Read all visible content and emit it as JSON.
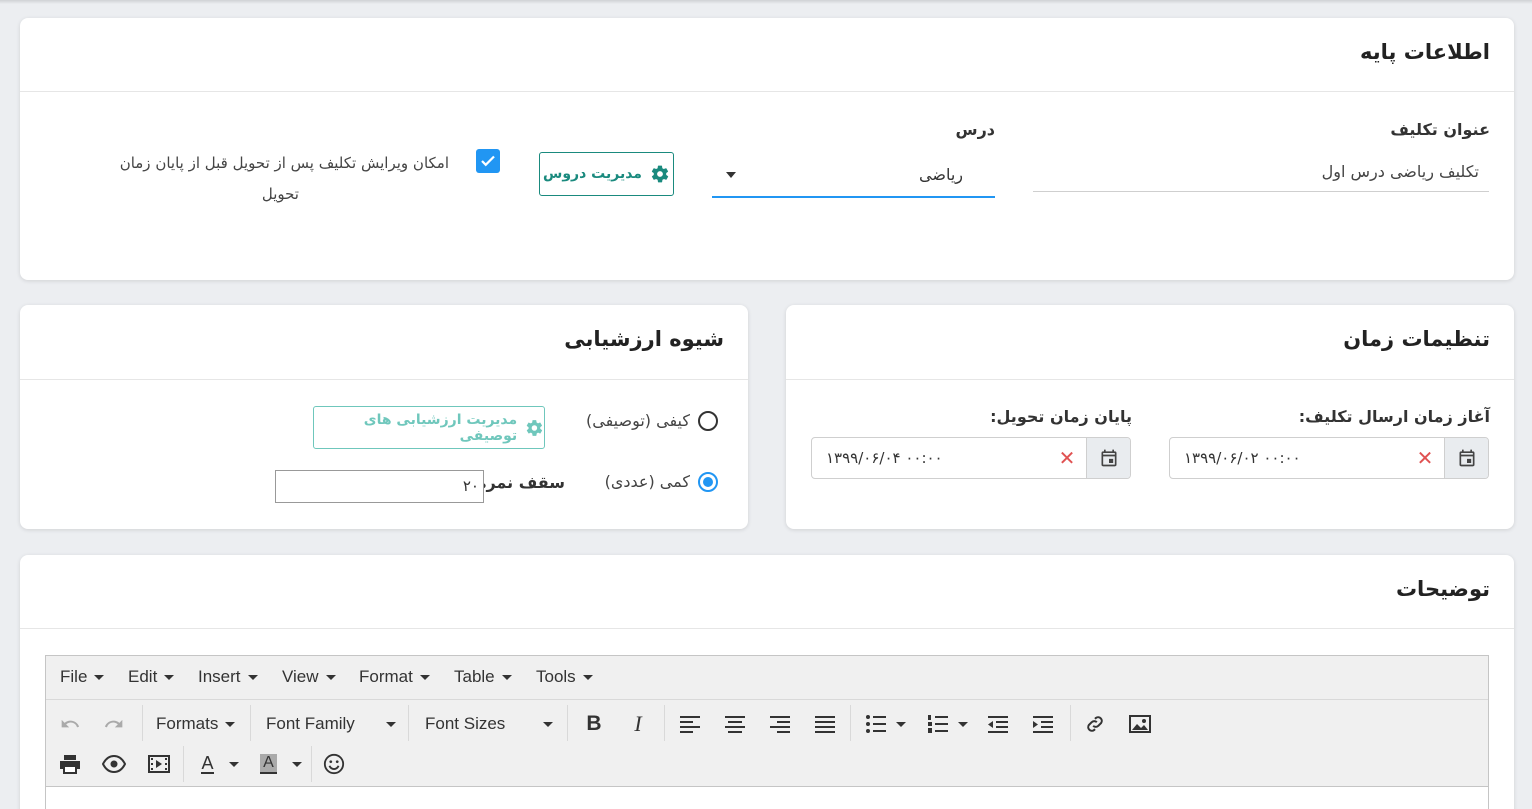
{
  "basic_info": {
    "title": "اطلاعات پایه",
    "homework_title_label": "عنوان تکلیف",
    "homework_title_value": "تکلیف ریاضی درس اول",
    "lesson_label": "درس",
    "lesson_value": "ریاضی",
    "manage_lessons_label": "مدیریت دروس",
    "edit_after_delivery_label_line1": "امکان ویرایش تکلیف پس از تحویل قبل از پایان زمان",
    "edit_after_delivery_label_line2": "تحویل",
    "edit_after_delivery_checked": true
  },
  "time_settings": {
    "title": "تنظیمات زمان",
    "start_label": "آغاز زمان ارسال تکلیف:",
    "start_value": "۱۳۹۹/۰۶/۰۲ ۰۰:۰۰",
    "end_label": "پایان زمان تحویل:",
    "end_value": "۱۳۹۹/۰۶/۰۴ ۰۰:۰۰"
  },
  "evaluation": {
    "title": "شیوه ارزشیابی",
    "qualitative_label": "کیفی (توصیفی)",
    "quantitative_label": "کمی (عددی)",
    "selected": "quantitative",
    "manage_descriptive_label": "مدیریت ارزشیابی های توصیفی",
    "max_score_label": "سقف نمره:",
    "max_score_value": "۲۰"
  },
  "description": {
    "title": "توضیحات",
    "menus": [
      "File",
      "Edit",
      "Insert",
      "View",
      "Format",
      "Table",
      "Tools"
    ],
    "formats_label": "Formats",
    "font_family_label": "Font Family",
    "font_sizes_label": "Font Sizes"
  },
  "colors": {
    "primary": "#2196f3",
    "teal": "#1a8a7e",
    "teal_light": "#6fc7bc"
  }
}
